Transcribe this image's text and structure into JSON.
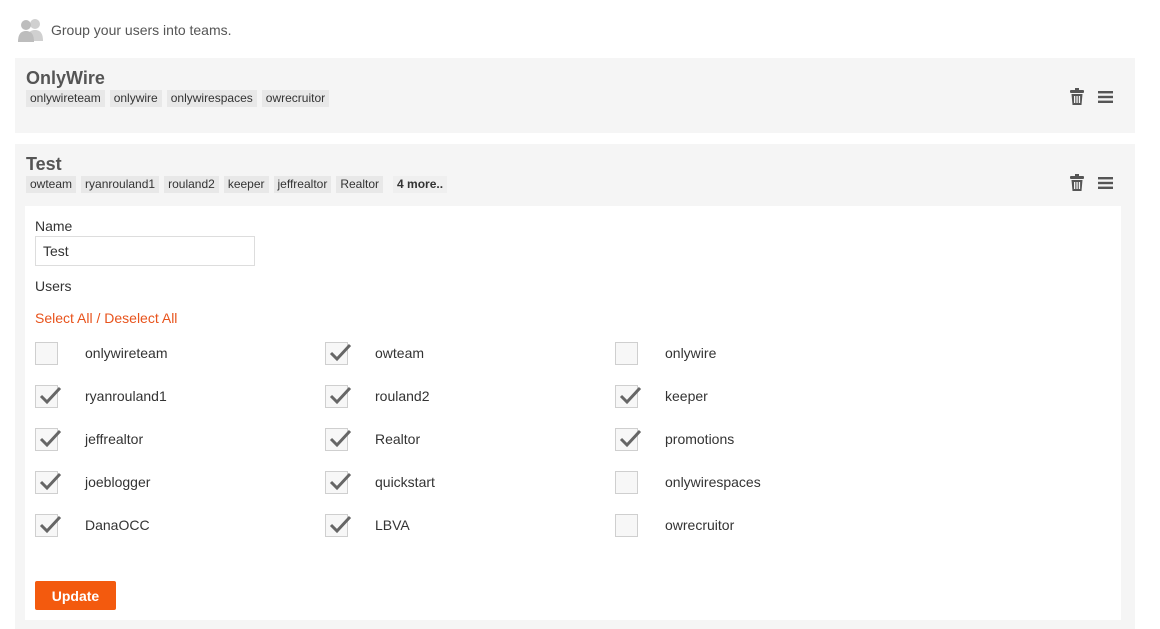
{
  "intro": {
    "icon": "users-icon",
    "text": "Group your users into teams."
  },
  "teams": [
    {
      "name": "OnlyWire",
      "tags": [
        "onlywireteam",
        "onlywire",
        "onlywirespaces",
        "owrecruitor"
      ],
      "actions": {
        "delete_icon": "trash-icon",
        "menu_icon": "menu-icon"
      }
    },
    {
      "name": "Test",
      "tags": [
        "owteam",
        "ryanrouland1",
        "rouland2",
        "keeper",
        "jeffrealtor",
        "Realtor"
      ],
      "more_label": "4 more..",
      "actions": {
        "delete_icon": "trash-icon",
        "menu_icon": "menu-icon"
      }
    }
  ],
  "edit_form": {
    "name_label": "Name",
    "name_value": "Test",
    "users_label": "Users",
    "select_all": "Select All",
    "separator": " / ",
    "deselect_all": "Deselect All",
    "users": [
      {
        "label": "onlywireteam",
        "checked": false
      },
      {
        "label": "owteam",
        "checked": true
      },
      {
        "label": "onlywire",
        "checked": false
      },
      {
        "label": "ryanrouland1",
        "checked": true
      },
      {
        "label": "rouland2",
        "checked": true
      },
      {
        "label": "keeper",
        "checked": true
      },
      {
        "label": "jeffrealtor",
        "checked": true
      },
      {
        "label": "Realtor",
        "checked": true
      },
      {
        "label": "promotions",
        "checked": true
      },
      {
        "label": "joeblogger",
        "checked": true
      },
      {
        "label": "quickstart",
        "checked": true
      },
      {
        "label": "onlywirespaces",
        "checked": false
      },
      {
        "label": "DanaOCC",
        "checked": true
      },
      {
        "label": "LBVA",
        "checked": true
      },
      {
        "label": "owrecruitor",
        "checked": false
      }
    ],
    "update_label": "Update"
  },
  "colors": {
    "accent": "#f35a0e",
    "link": "#e8531c",
    "card_bg": "#f5f5f5",
    "check": "#666666"
  }
}
